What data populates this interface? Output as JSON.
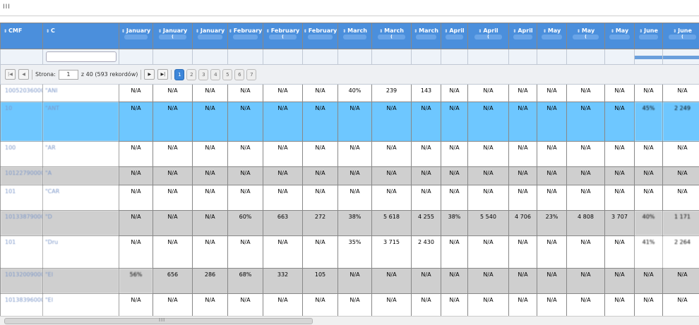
{
  "topbar": {
    "menu_glyph": "III"
  },
  "headers": [
    {
      "label": "CMF",
      "sub": ""
    },
    {
      "label": "C",
      "sub": ""
    },
    {
      "label": "January",
      "sub": ""
    },
    {
      "label": "January",
      "sub": "("
    },
    {
      "label": "January",
      "sub": ""
    },
    {
      "label": "February",
      "sub": ""
    },
    {
      "label": "February",
      "sub": "("
    },
    {
      "label": "February",
      "sub": ""
    },
    {
      "label": "March",
      "sub": ""
    },
    {
      "label": "March",
      "sub": "("
    },
    {
      "label": "March",
      "sub": ""
    },
    {
      "label": "April",
      "sub": ""
    },
    {
      "label": "April",
      "sub": "("
    },
    {
      "label": "April",
      "sub": ""
    },
    {
      "label": "May",
      "sub": ""
    },
    {
      "label": "May",
      "sub": "("
    },
    {
      "label": "May",
      "sub": ""
    },
    {
      "label": "June",
      "sub": ""
    },
    {
      "label": "June",
      "sub": "("
    }
  ],
  "pager": {
    "page_label": "Strona:",
    "page_value": "1",
    "total_label": "z 40 (593 rekordów)",
    "pages": [
      "1",
      "2",
      "3",
      "4",
      "5",
      "6",
      "7"
    ],
    "first_icon": "first-page-icon",
    "prev_icon": "prev-page-icon",
    "next_icon": "next-page-icon",
    "last_icon": "last-page-icon"
  },
  "rows": [
    {
      "style": "white",
      "code": "10052036000",
      "name": "\"ANI",
      "cells": [
        "N/A",
        "N/A",
        "N/A",
        "N/A",
        "N/A",
        "N/A",
        "40%",
        "239",
        "143",
        "N/A",
        "N/A",
        "N/A",
        "N/A",
        "N/A",
        "N/A",
        "N/A",
        "N/A"
      ]
    },
    {
      "style": "sel",
      "code": "10",
      "name": "\"ANT",
      "cells": [
        "N/A",
        "N/A",
        "N/A",
        "N/A",
        "N/A",
        "N/A",
        "N/A",
        "N/A",
        "N/A",
        "N/A",
        "N/A",
        "N/A",
        "N/A",
        "N/A",
        "N/A",
        "45%",
        "2 249"
      ]
    },
    {
      "style": "white",
      "code": "100",
      "name": "\"AR",
      "cells": [
        "N/A",
        "N/A",
        "N/A",
        "N/A",
        "N/A",
        "N/A",
        "N/A",
        "N/A",
        "N/A",
        "N/A",
        "N/A",
        "N/A",
        "N/A",
        "N/A",
        "N/A",
        "N/A",
        "N/A"
      ]
    },
    {
      "style": "grey",
      "code": "10122790000",
      "name": "\"A",
      "cells": [
        "N/A",
        "N/A",
        "N/A",
        "N/A",
        "N/A",
        "N/A",
        "N/A",
        "N/A",
        "N/A",
        "N/A",
        "N/A",
        "N/A",
        "N/A",
        "N/A",
        "N/A",
        "N/A",
        "N/A"
      ]
    },
    {
      "style": "white",
      "code": "101",
      "name": "\"CAR",
      "cells": [
        "N/A",
        "N/A",
        "N/A",
        "N/A",
        "N/A",
        "N/A",
        "N/A",
        "N/A",
        "N/A",
        "N/A",
        "N/A",
        "N/A",
        "N/A",
        "N/A",
        "N/A",
        "N/A",
        "N/A"
      ]
    },
    {
      "style": "grey",
      "code": "10133879000",
      "name": "\"D",
      "cells": [
        "N/A",
        "N/A",
        "N/A",
        "60%",
        "663",
        "272",
        "38%",
        "5 618",
        "4 255",
        "38%",
        "5 540",
        "4 706",
        "23%",
        "4 808",
        "3 707",
        "40%",
        "1 171"
      ]
    },
    {
      "style": "white",
      "code": "101",
      "name": "\"Dru",
      "cells": [
        "N/A",
        "N/A",
        "N/A",
        "N/A",
        "N/A",
        "N/A",
        "35%",
        "3 715",
        "2 430",
        "N/A",
        "N/A",
        "N/A",
        "N/A",
        "N/A",
        "N/A",
        "41%",
        "2 264"
      ]
    },
    {
      "style": "grey",
      "code": "10132009000",
      "name": "\"El",
      "cells": [
        "56%",
        "656",
        "286",
        "68%",
        "332",
        "105",
        "N/A",
        "N/A",
        "N/A",
        "N/A",
        "N/A",
        "N/A",
        "N/A",
        "N/A",
        "N/A",
        "N/A",
        "N/A"
      ]
    },
    {
      "style": "white",
      "code": "10138396000",
      "name": "\"El",
      "cells": [
        "N/A",
        "N/A",
        "N/A",
        "N/A",
        "N/A",
        "N/A",
        "N/A",
        "N/A",
        "N/A",
        "N/A",
        "N/A",
        "N/A",
        "N/A",
        "N/A",
        "N/A",
        "N/A",
        "N/A"
      ]
    }
  ],
  "scrollbar": {
    "grip": "III"
  }
}
